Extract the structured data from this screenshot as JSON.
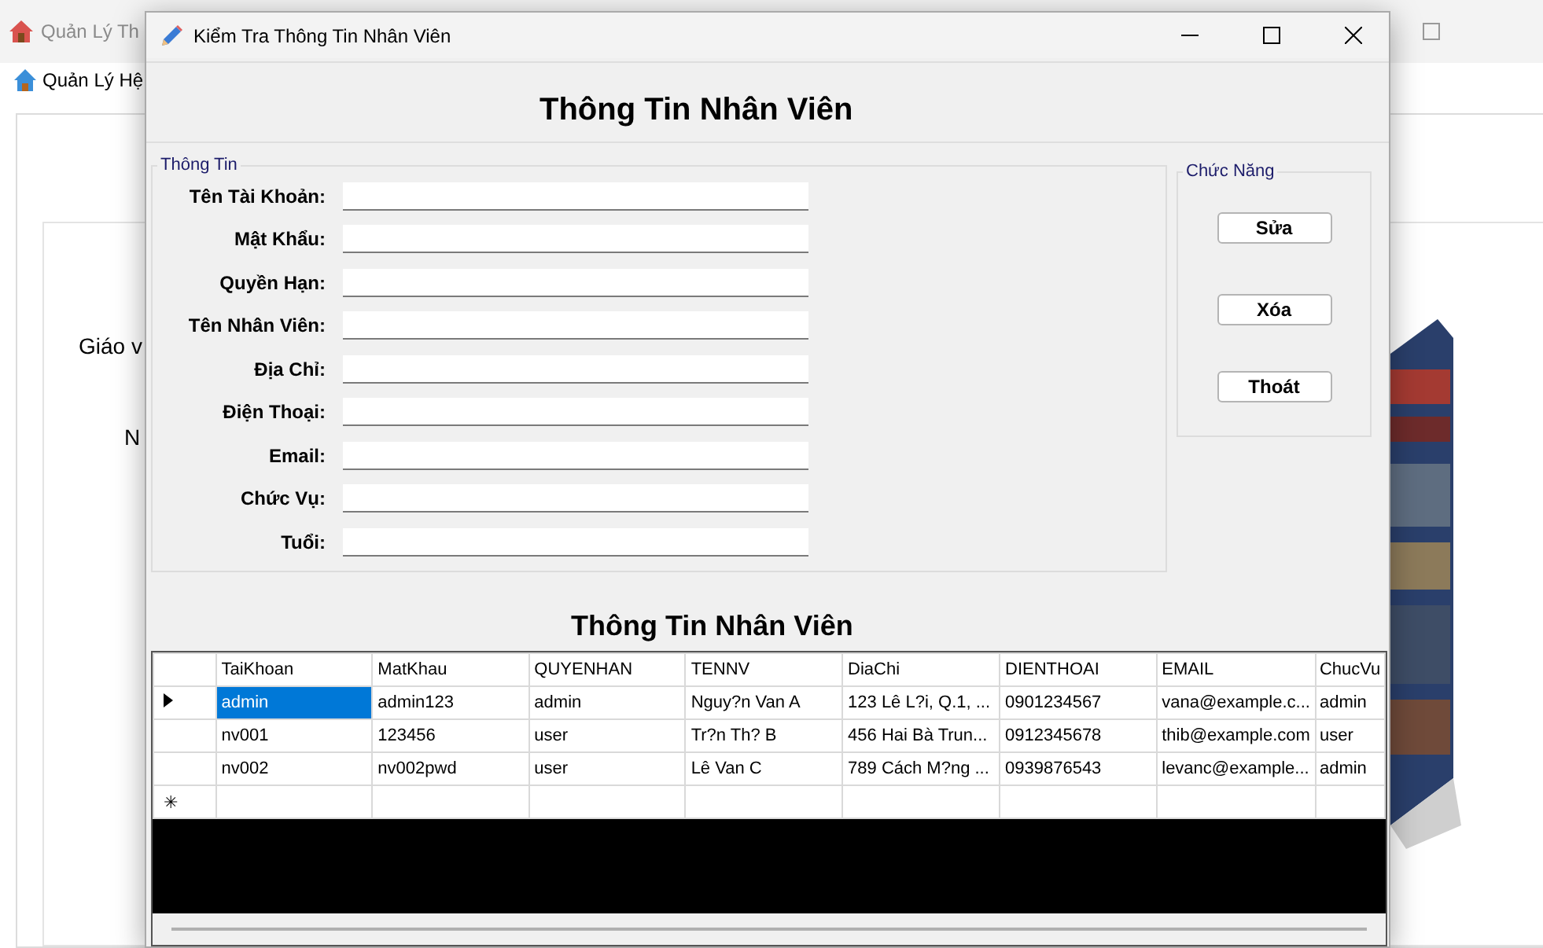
{
  "background_window": {
    "title": "Quản Lý Th",
    "menu": [
      {
        "label": "Quản Lý Hệ"
      }
    ],
    "texts": [
      "Giáo v",
      "N"
    ],
    "picture": {
      "kind": "picture"
    }
  },
  "dialog": {
    "title": "Kiểm Tra Thông Tin Nhân Viên",
    "heading": "Thông Tin Nhân Viên",
    "info_group": {
      "title": "Thông Tin",
      "fields": [
        {
          "label": "Tên Tài Khoản:"
        },
        {
          "label": "Mật Khẩu:"
        },
        {
          "label": "Quyền Hạn:"
        },
        {
          "label": "Tên Nhân Viên:"
        },
        {
          "label": "Địa Chỉ:"
        },
        {
          "label": "Điện Thoại:"
        },
        {
          "label": "Email:"
        },
        {
          "label": "Chức Vụ:"
        },
        {
          "label": "Tuổi:"
        }
      ]
    },
    "actions_group": {
      "title": "Chức Năng",
      "buttons": [
        "Sửa",
        "Xóa",
        "Thoát"
      ]
    },
    "table_heading": "Thông Tin Nhân Viên",
    "table": {
      "columns": [
        "TaiKhoan",
        "MatKhau",
        "QUYENHAN",
        "TENNV",
        "DiaChi",
        "DIENTHOAI",
        "EMAIL",
        "ChucVu"
      ],
      "rows": [
        {
          "current": true,
          "cells": [
            {
              "text": "admin",
              "selected": true
            },
            {
              "text": "admin123",
              "selected": false
            },
            {
              "text": "admin",
              "selected": false
            },
            {
              "text": "Nguy?n Van A",
              "selected": false
            },
            {
              "text": "123 Lê L?i, Q.1, ...",
              "selected": false
            },
            {
              "text": "0901234567",
              "selected": false
            },
            {
              "text": "vana@example.c...",
              "selected": false
            },
            {
              "text": "admin",
              "selected": false
            }
          ]
        },
        {
          "current": false,
          "cells": [
            {
              "text": "nv001",
              "selected": false
            },
            {
              "text": "123456",
              "selected": false
            },
            {
              "text": "user",
              "selected": false
            },
            {
              "text": "Tr?n Th? B",
              "selected": false
            },
            {
              "text": "456 Hai Bà Trun...",
              "selected": false
            },
            {
              "text": "0912345678",
              "selected": false
            },
            {
              "text": "thib@example.com",
              "selected": false
            },
            {
              "text": "user",
              "selected": false
            }
          ]
        },
        {
          "current": false,
          "cells": [
            {
              "text": "nv002",
              "selected": false
            },
            {
              "text": "nv002pwd",
              "selected": false
            },
            {
              "text": "user",
              "selected": false
            },
            {
              "text": "Lê Van C",
              "selected": false
            },
            {
              "text": "789 Cách M?ng ...",
              "selected": false
            },
            {
              "text": "0939876543",
              "selected": false
            },
            {
              "text": "levanc@example...",
              "selected": false
            },
            {
              "text": "admin",
              "selected": false
            }
          ]
        }
      ],
      "new_row_marker": "✳"
    }
  }
}
